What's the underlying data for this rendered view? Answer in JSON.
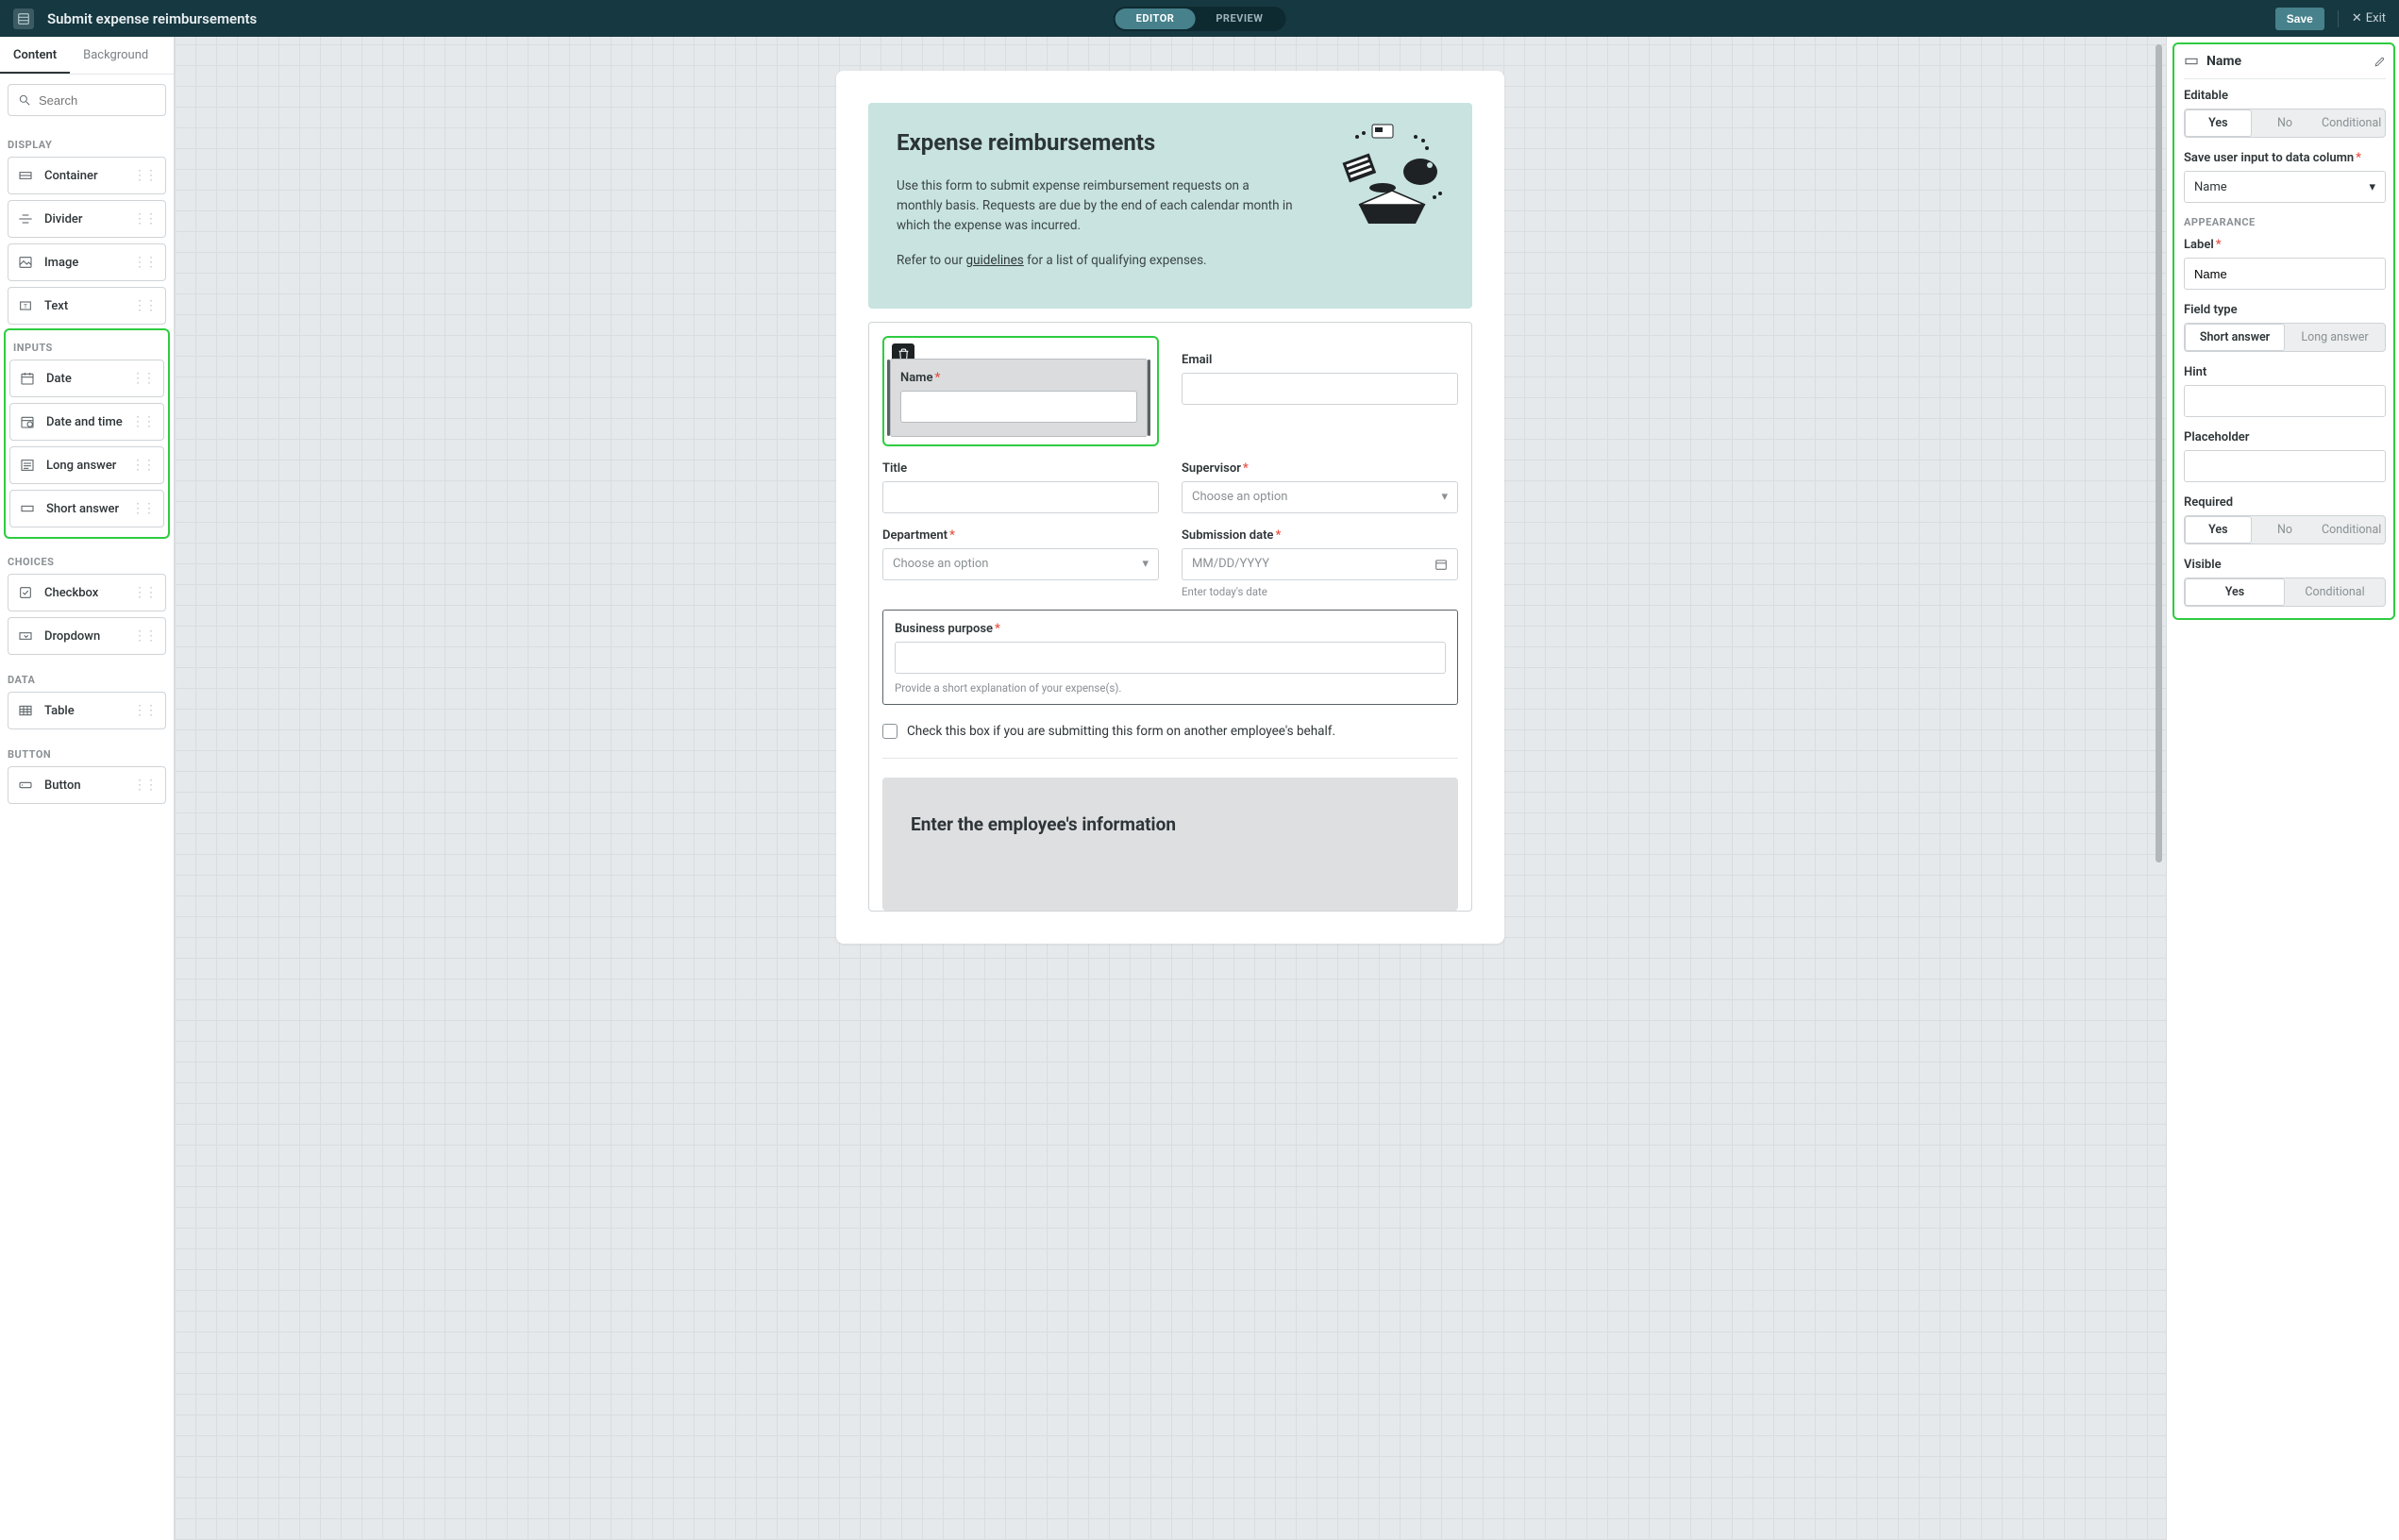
{
  "topbar": {
    "title": "Submit expense reimbursements",
    "mode_editor": "EDITOR",
    "mode_preview": "PREVIEW",
    "save": "Save",
    "exit": "Exit"
  },
  "left": {
    "tab_content": "Content",
    "tab_background": "Background",
    "search_placeholder": "Search",
    "cat_display": "DISPLAY",
    "display_items": {
      "container": "Container",
      "divider": "Divider",
      "image": "Image",
      "text": "Text"
    },
    "cat_inputs": "INPUTS",
    "input_items": {
      "date": "Date",
      "datetime": "Date and time",
      "long": "Long answer",
      "short": "Short answer"
    },
    "cat_choices": "CHOICES",
    "choice_items": {
      "checkbox": "Checkbox",
      "dropdown": "Dropdown"
    },
    "cat_data": "DATA",
    "data_items": {
      "table": "Table"
    },
    "cat_button": "BUTTON",
    "button_items": {
      "button": "Button"
    }
  },
  "form": {
    "banner_title": "Expense reimbursements",
    "banner_p1": "Use this form to submit expense reimbursement requests on a monthly basis. Requests are due by the end of each calendar month in which the expense was incurred.",
    "banner_p2_pre": "Refer to our ",
    "banner_p2_link": "guidelines",
    "banner_p2_post": " for a list of qualifying expenses.",
    "name_label": "Name",
    "email_label": "Email",
    "title_label": "Title",
    "supervisor_label": "Supervisor",
    "department_label": "Department",
    "date_label": "Submission date",
    "date_placeholder": "MM/DD/YYYY",
    "date_hint": "Enter today's date",
    "select_placeholder": "Choose an option",
    "purpose_label": "Business purpose",
    "purpose_hint": "Provide a short explanation of your expense(s).",
    "checkbox_text": "Check this box if you are submitting this form on another employee's behalf.",
    "section_title": "Enter the employee's information"
  },
  "right": {
    "title": "Name",
    "editable_label": "Editable",
    "save_col_label": "Save user input to data column",
    "save_col_value": "Name",
    "appearance": "APPEARANCE",
    "label_label": "Label",
    "label_value": "Name",
    "fieldtype_label": "Field type",
    "ft_short": "Short answer",
    "ft_long": "Long answer",
    "hint_label": "Hint",
    "placeholder_label": "Placeholder",
    "required_label": "Required",
    "visible_label": "Visible",
    "seg_yes": "Yes",
    "seg_no": "No",
    "seg_cond": "Conditional"
  }
}
